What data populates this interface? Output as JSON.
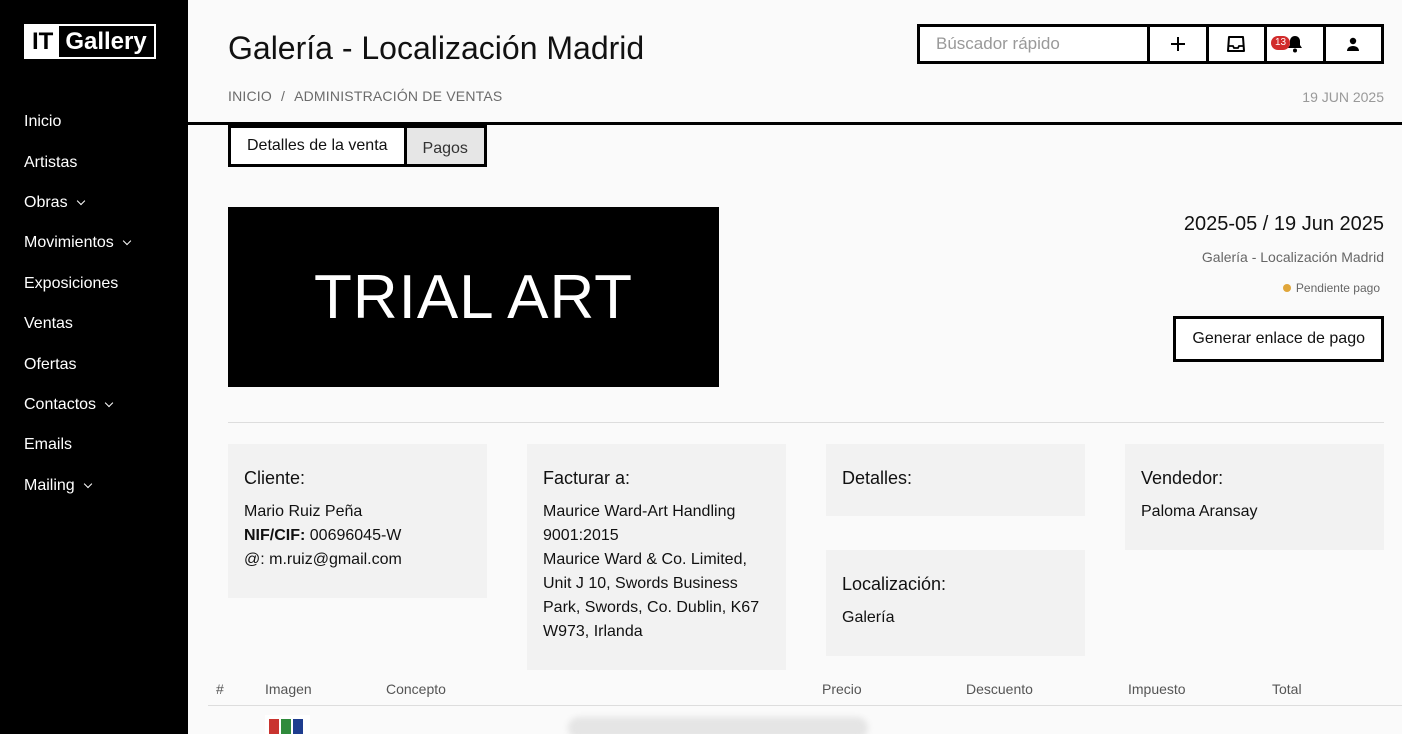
{
  "sidebar": {
    "logo": {
      "part1": "IT",
      "part2": "Gallery"
    },
    "items": [
      {
        "label": "Inicio",
        "has_children": false
      },
      {
        "label": "Artistas",
        "has_children": false
      },
      {
        "label": "Obras",
        "has_children": true
      },
      {
        "label": "Movimientos",
        "has_children": true
      },
      {
        "label": "Exposiciones",
        "has_children": false
      },
      {
        "label": "Ventas",
        "has_children": false
      },
      {
        "label": "Ofertas",
        "has_children": false
      },
      {
        "label": "Contactos",
        "has_children": true
      },
      {
        "label": "Emails",
        "has_children": false
      },
      {
        "label": "Mailing",
        "has_children": true
      }
    ]
  },
  "header": {
    "title": "Galería - Localización Madrid",
    "breadcrumb": [
      "INICIO",
      "ADMINISTRACIÓN DE VENTAS"
    ],
    "breadcrumb_sep": "/",
    "date": "19 JUN 2025",
    "search_placeholder": "Búscador rápido",
    "notifications_count": "13",
    "icons": [
      "plus-icon",
      "inbox-icon",
      "bell-icon",
      "user-icon"
    ]
  },
  "tabs": [
    {
      "label": "Detalles de la venta",
      "active": true
    },
    {
      "label": "Pagos",
      "active": false
    }
  ],
  "banner": {
    "text": "TRIAL ART"
  },
  "sale": {
    "id_date": "2025-05 / 19 Jun 2025",
    "location": "Galería - Localización Madrid",
    "status": "Pendiente pago",
    "status_color": "#e0a63a",
    "payment_link_button": "Generar enlace de pago"
  },
  "cards": {
    "client": {
      "title": "Cliente:",
      "name": "Mario Ruiz Peña",
      "nif_label": "NIF/CIF:",
      "nif": "00696045-W",
      "email_label": "@:",
      "email": "m.ruiz@gmail.com"
    },
    "billing": {
      "title": "Facturar a:",
      "lines": [
        "Maurice Ward-Art Handling",
        "9001:2015",
        "Maurice Ward & Co. Limited,",
        "Unit J 10, Swords Business",
        "Park, Swords, Co. Dublin, K67",
        "W973, Irlanda"
      ]
    },
    "details": {
      "title": "Detalles:"
    },
    "location": {
      "title": "Localización:",
      "value": "Galería"
    },
    "seller": {
      "title": "Vendedor:",
      "name": "Paloma Aransay"
    }
  },
  "table": {
    "headers": [
      "#",
      "Imagen",
      "Concepto",
      "Precio",
      "Descuento",
      "Impuesto",
      "Total"
    ]
  }
}
